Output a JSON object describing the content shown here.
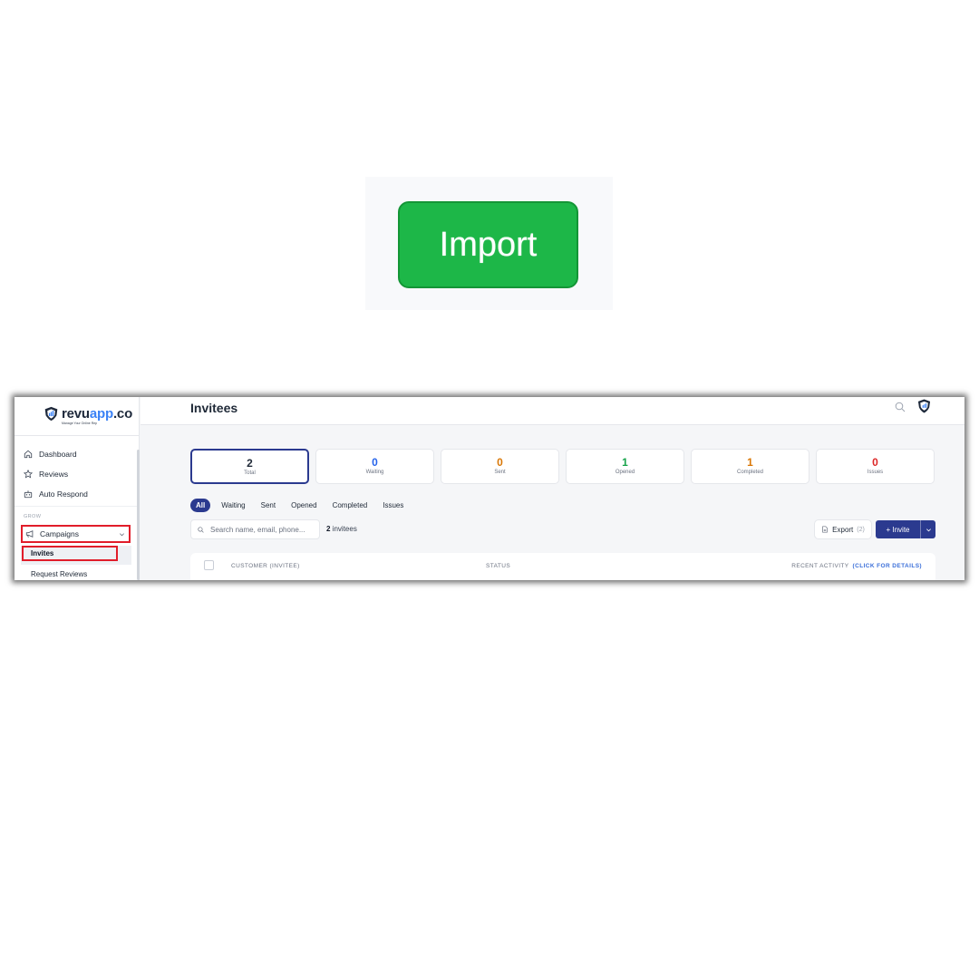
{
  "callout": {
    "import_label": "Import"
  },
  "sidebar": {
    "logo": {
      "prefix": "revu",
      "accent": "app",
      "suffix": ".co",
      "tagline": "Manage Your Online Rep"
    },
    "items": [
      {
        "label": "Dashboard",
        "icon": "home-icon"
      },
      {
        "label": "Reviews",
        "icon": "star-icon"
      },
      {
        "label": "Auto Respond",
        "icon": "robot-icon"
      }
    ],
    "section_label": "GROW",
    "campaigns_label": "Campaigns",
    "invites_label": "Invites",
    "request_reviews_label": "Request Reviews"
  },
  "header": {
    "title": "Invitees"
  },
  "stats": [
    {
      "value": "2",
      "label": "Total",
      "color": "#111827"
    },
    {
      "value": "0",
      "label": "Waiting",
      "color": "#2563eb"
    },
    {
      "value": "0",
      "label": "Sent",
      "color": "#d97706"
    },
    {
      "value": "1",
      "label": "Opened",
      "color": "#16a34a"
    },
    {
      "value": "1",
      "label": "Completed",
      "color": "#d97706"
    },
    {
      "value": "0",
      "label": "Issues",
      "color": "#dc2626"
    }
  ],
  "tabs": [
    "All",
    "Waiting",
    "Sent",
    "Opened",
    "Completed",
    "Issues"
  ],
  "search": {
    "placeholder": "Search name, email, phone..."
  },
  "invitee_count": {
    "number": "2",
    "label": "invitees"
  },
  "export": {
    "label": "Export",
    "count": "(2)"
  },
  "invite": {
    "label": "+ Invite"
  },
  "table": {
    "columns": {
      "customer": "CUSTOMER (INVITEE)",
      "status": "STATUS",
      "activity": "RECENT ACTIVITY",
      "activity_link": "(CLICK FOR DETAILS)"
    }
  },
  "colors": {
    "accent": "#2b3a8f",
    "import_green": "#1db748",
    "highlight_red": "#e11d2a"
  }
}
